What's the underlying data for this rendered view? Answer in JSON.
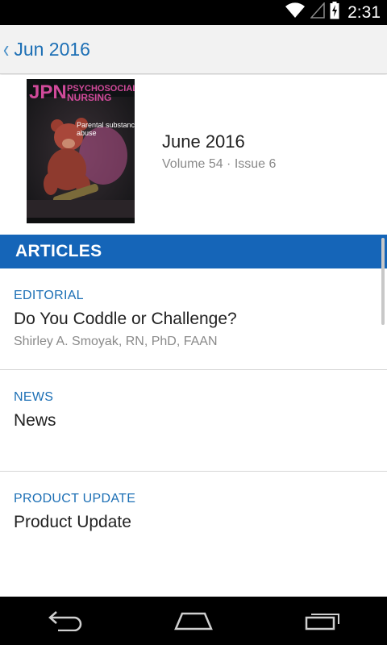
{
  "status_bar": {
    "time": "2:31",
    "icons": [
      "wifi-icon",
      "signal-icon",
      "battery-charging-icon"
    ]
  },
  "action_bar": {
    "back_icon": "chevron-left-icon",
    "title": "Jun 2016"
  },
  "issue": {
    "cover": {
      "masthead": "JPN",
      "journal_line1": "PSYCHOSOCIAL",
      "journal_line2": "NURSING",
      "headline1": "Parental substance",
      "headline2": "abuse"
    },
    "title": "June 2016",
    "subtitle": "Volume 54 · Issue 6"
  },
  "section": {
    "title": "ARTICLES"
  },
  "articles": [
    {
      "category": "EDITORIAL",
      "title": "Do You Coddle or Challenge?",
      "authors": "Shirley A. Smoyak, RN, PhD, FAAN"
    },
    {
      "category": "NEWS",
      "title": "News",
      "authors": ""
    },
    {
      "category": "PRODUCT UPDATE",
      "title": "Product Update",
      "authors": ""
    }
  ],
  "nav_bar": {
    "buttons": [
      "back-icon",
      "home-icon",
      "recent-apps-icon"
    ]
  },
  "colors": {
    "accent": "#1565b8",
    "link": "#1c6fb5",
    "action_bar_bg": "#f2f2f2"
  }
}
